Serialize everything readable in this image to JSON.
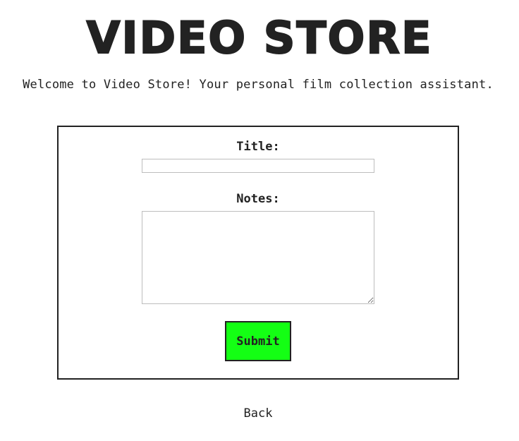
{
  "header": {
    "title": "VIDEO STORE",
    "welcome": "Welcome to Video Store! Your personal film collection assistant."
  },
  "form": {
    "title_label": "Title:",
    "title_value": "",
    "notes_label": "Notes:",
    "notes_value": "",
    "submit_label": "Submit"
  },
  "nav": {
    "back_label": "Back"
  },
  "colors": {
    "text": "#222222",
    "submit_bg": "#14ff14",
    "border": "#222222",
    "input_border": "#bdbdbd",
    "background": "#ffffff"
  }
}
